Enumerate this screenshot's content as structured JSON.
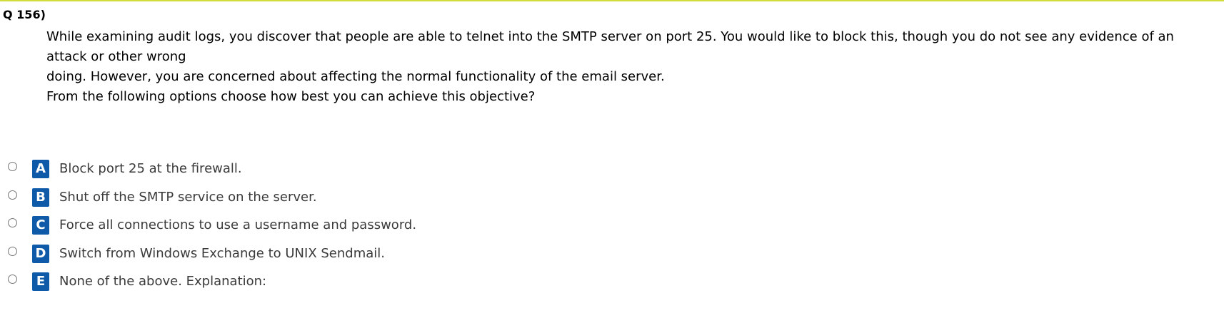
{
  "question": {
    "number_label": "Q 156)",
    "stem_lines": [
      "While examining audit logs, you discover that people are able to telnet into the SMTP server on port 25. You would like to block this, though you do not see any evidence of an",
      "attack or other wrong",
      "doing. However, you are concerned about affecting the normal functionality of the email server.",
      "From the following options choose how best you can achieve this objective?"
    ]
  },
  "options": [
    {
      "letter": "A",
      "text": "Block port 25 at the firewall."
    },
    {
      "letter": "B",
      "text": "Shut off the SMTP service on the server."
    },
    {
      "letter": "C",
      "text": "Force all connections to use a username and password."
    },
    {
      "letter": "D",
      "text": "Switch from Windows Exchange to UNIX Sendmail."
    },
    {
      "letter": "E",
      "text": "None of the above. Explanation:"
    }
  ],
  "colors": {
    "badge_background": "#0f5aa8",
    "top_rule": "#cfdc3a"
  }
}
